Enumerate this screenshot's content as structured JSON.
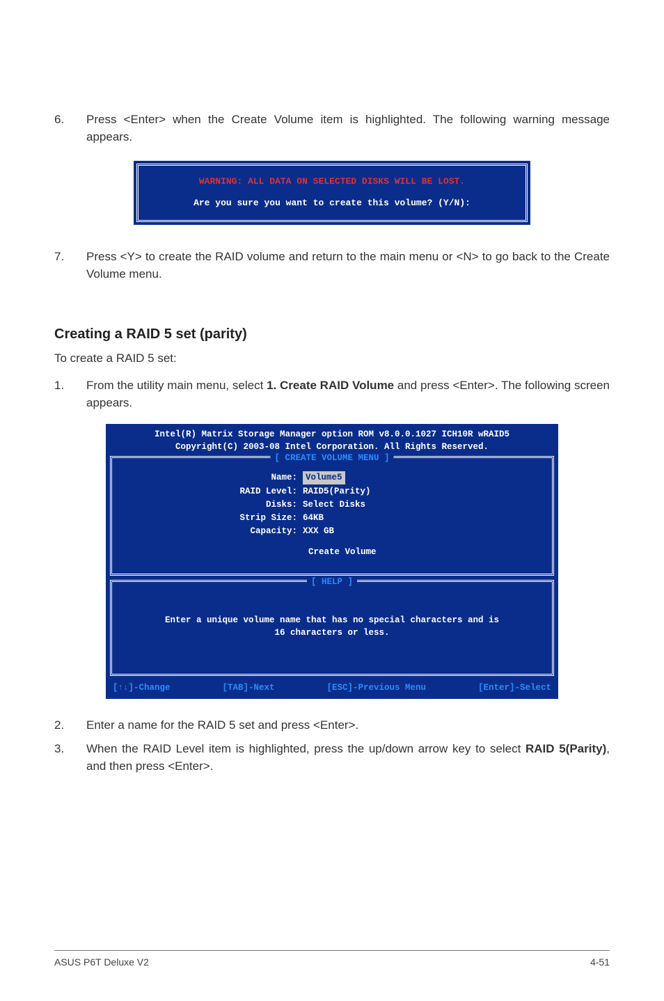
{
  "steps": {
    "s6": {
      "num": "6.",
      "text": "Press <Enter> when the Create Volume item is highlighted. The following warning message appears."
    },
    "s7": {
      "num": "7.",
      "text": "Press <Y> to create the RAID volume and return to the main menu or <N> to go back to the Create Volume menu."
    },
    "s1": {
      "num": "1.",
      "prefix": "From the utility main menu, select ",
      "bold": "1. Create RAID Volume",
      "suffix": " and press <Enter>. The following screen appears."
    },
    "s2": {
      "num": "2.",
      "text": "Enter a name for the RAID 5 set and press <Enter>."
    },
    "s3": {
      "num": "3.",
      "prefix": "When the RAID Level item is highlighted, press the up/down arrow key to select ",
      "bold": "RAID 5(Parity)",
      "suffix": ", and then press <Enter>."
    }
  },
  "dialog": {
    "warn": "WARNING: ALL DATA ON SELECTED DISKS WILL BE LOST.",
    "confirm": "Are you sure you want to create this volume? (Y/N):"
  },
  "section": {
    "heading": "Creating a RAID 5 set (parity)",
    "sub": "To create a RAID 5 set:"
  },
  "bios": {
    "title1": "Intel(R) Matrix Storage Manager option ROM v8.0.0.1027 ICH10R wRAID5",
    "title2": "Copyright(C) 2003-08 Intel Corporation. All Rights Reserved.",
    "panel1": {
      "title": "[ CREATE VOLUME MENU ]",
      "rows": {
        "name": {
          "k": "Name:",
          "v": "Volume5"
        },
        "level": {
          "k": "RAID Level:",
          "v": "RAID5(Parity)"
        },
        "disks": {
          "k": "Disks:",
          "v": "Select Disks"
        },
        "strip": {
          "k": "Strip Size:",
          "v": "64KB"
        },
        "capacity": {
          "k": "Capacity:",
          "v": "XXX   GB"
        }
      },
      "create": "Create Volume"
    },
    "panel2": {
      "title": "[ HELP ]",
      "line1": "Enter a unique volume name that has no special characters and is",
      "line2": "16 characters or less."
    },
    "foot": {
      "a": "[↑↓]-Change",
      "b": "[TAB]-Next",
      "c": "[ESC]-Previous Menu",
      "d": "[Enter]-Select"
    }
  },
  "footer": {
    "left": "ASUS P6T Deluxe V2",
    "right": "4-51"
  }
}
